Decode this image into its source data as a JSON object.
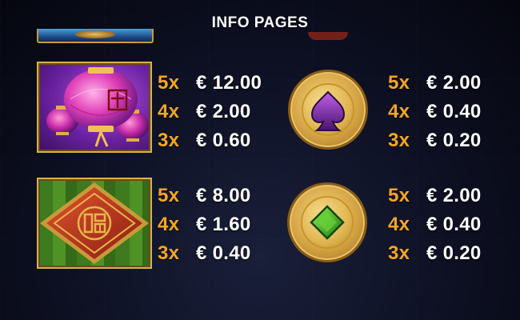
{
  "header": {
    "title": "INFO PAGES"
  },
  "symbols": [
    {
      "icon": "lantern-icon",
      "payouts": [
        {
          "count": "5x",
          "value": "€ 12.00"
        },
        {
          "count": "4x",
          "value": "€ 2.00"
        },
        {
          "count": "3x",
          "value": "€ 0.60"
        }
      ]
    },
    {
      "icon": "spade-icon",
      "payouts": [
        {
          "count": "5x",
          "value": "€ 2.00"
        },
        {
          "count": "4x",
          "value": "€ 0.40"
        },
        {
          "count": "3x",
          "value": "€ 0.20"
        }
      ]
    },
    {
      "icon": "fu-tile-icon",
      "payouts": [
        {
          "count": "5x",
          "value": "€ 8.00"
        },
        {
          "count": "4x",
          "value": "€ 1.60"
        },
        {
          "count": "3x",
          "value": "€ 0.40"
        }
      ]
    },
    {
      "icon": "diamond-icon",
      "payouts": [
        {
          "count": "5x",
          "value": "€ 2.00"
        },
        {
          "count": "4x",
          "value": "€ 0.40"
        },
        {
          "count": "3x",
          "value": "€ 0.20"
        }
      ]
    }
  ],
  "colors": {
    "multiplier": "#f5a623",
    "value": "#ffffff",
    "frame_gold": "#d9b24a",
    "background": "#0d1022"
  }
}
